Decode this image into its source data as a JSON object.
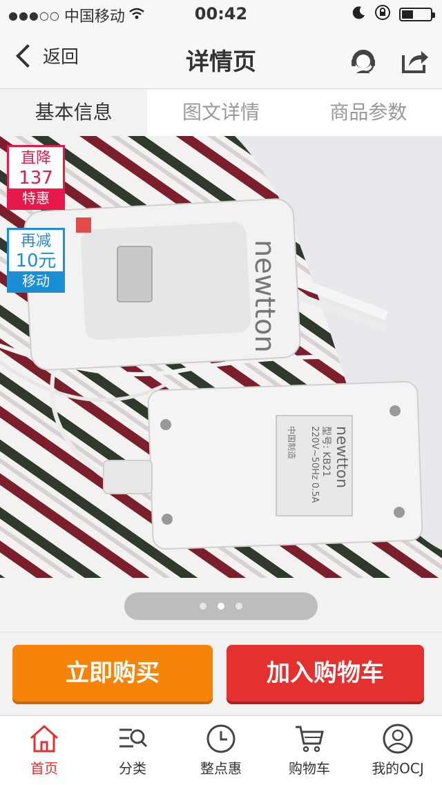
{
  "status_bar": {
    "carrier": "中国移动",
    "time": "00:42"
  },
  "nav": {
    "back_label": "返回",
    "title": "详情页"
  },
  "tabs": [
    {
      "label": "基本信息",
      "active": true
    },
    {
      "label": "图文详情",
      "active": false
    },
    {
      "label": "商品参数",
      "active": false
    }
  ],
  "badges": {
    "price_drop": {
      "line1": "直降",
      "amount": "137",
      "line3": "特惠"
    },
    "discount": {
      "line1": "再减",
      "amount": "10元",
      "line3": "移动"
    }
  },
  "product_image": {
    "brand_text": "newtton",
    "model_text": "型号: KB21",
    "spec_text": "220V~50Hz 0.5A",
    "origin_text": "中国制造"
  },
  "gallery": {
    "dots": 3,
    "active_index": 1
  },
  "actions": {
    "buy_now": "立即购买",
    "add_to_cart": "加入购物车"
  },
  "tabbar": [
    {
      "label": "首页",
      "icon": "home-icon",
      "active": true
    },
    {
      "label": "分类",
      "icon": "category-search-icon",
      "active": false
    },
    {
      "label": "整点惠",
      "icon": "clock-icon",
      "active": false
    },
    {
      "label": "购物车",
      "icon": "cart-icon",
      "active": false
    },
    {
      "label": "我的OCJ",
      "icon": "user-icon",
      "active": false
    }
  ],
  "colors": {
    "accent_red": "#e53030",
    "accent_orange": "#f7840a",
    "badge_red": "#e6194a",
    "badge_blue": "#1b8fd5"
  }
}
